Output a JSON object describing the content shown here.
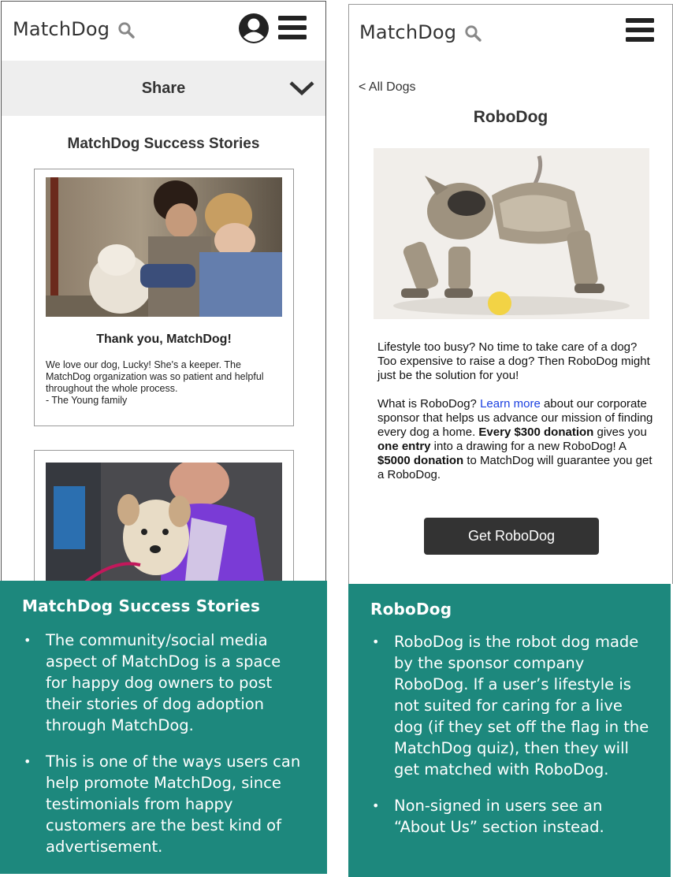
{
  "left_screen": {
    "logo": "MatchDog",
    "share_label": "Share",
    "heading": "MatchDog Success Stories",
    "story": {
      "title": "Thank you, MatchDog!",
      "body_lines": [
        "We love our dog, Lucky! She's a keeper. The",
        "MatchDog organization was so patient and helpful",
        "throughout the whole process.",
        "- The Young family"
      ]
    }
  },
  "right_screen": {
    "logo": "MatchDog",
    "back_label": "<  All Dogs",
    "title": "RoboDog",
    "para1": "Lifestyle too busy? No time to take care of a dog? Too expensive to raise a dog? Then RoboDog might just be the solution for you!",
    "para2": {
      "part1": "What is RoboDog? ",
      "link": "Learn more",
      "part2": " about our corporate sponsor that helps us advance our mission of finding every dog a home. ",
      "bold1": "Every $300 donation",
      "part3": " gives you ",
      "bold2": "one entry",
      "part4": " into a drawing for a new RoboDog! A ",
      "bold3": "$5000 donation",
      "part5": " to MatchDog will guarantee you get a RoboDog."
    },
    "cta_label": "Get RoboDog"
  },
  "notes": {
    "left": {
      "title": "MatchDog Success Stories",
      "bullets": [
        "The community/social media aspect of MatchDog is a space for happy dog owners to post their stories of dog adoption through MatchDog.",
        "This is one of the ways users can help promote MatchDog, since testimonials from happy customers are the best kind of advertisement."
      ]
    },
    "right": {
      "title": "RoboDog",
      "bullets": [
        "RoboDog is the robot dog made by the sponsor company RoboDog. If a user’s lifestyle is not suited for caring for a live dog (if they set off the flag in the MatchDog quiz), then they will get matched with RoboDog.",
        "Non-signed in users see an “About Us” section instead."
      ]
    }
  },
  "colors": {
    "note_background": "#1d887d",
    "button": "#333333",
    "link": "#1a3fe0",
    "share_bar": "#eeeeee"
  },
  "icons": [
    "search-icon",
    "user-avatar-icon",
    "hamburger-menu-icon",
    "chevron-down-icon"
  ]
}
